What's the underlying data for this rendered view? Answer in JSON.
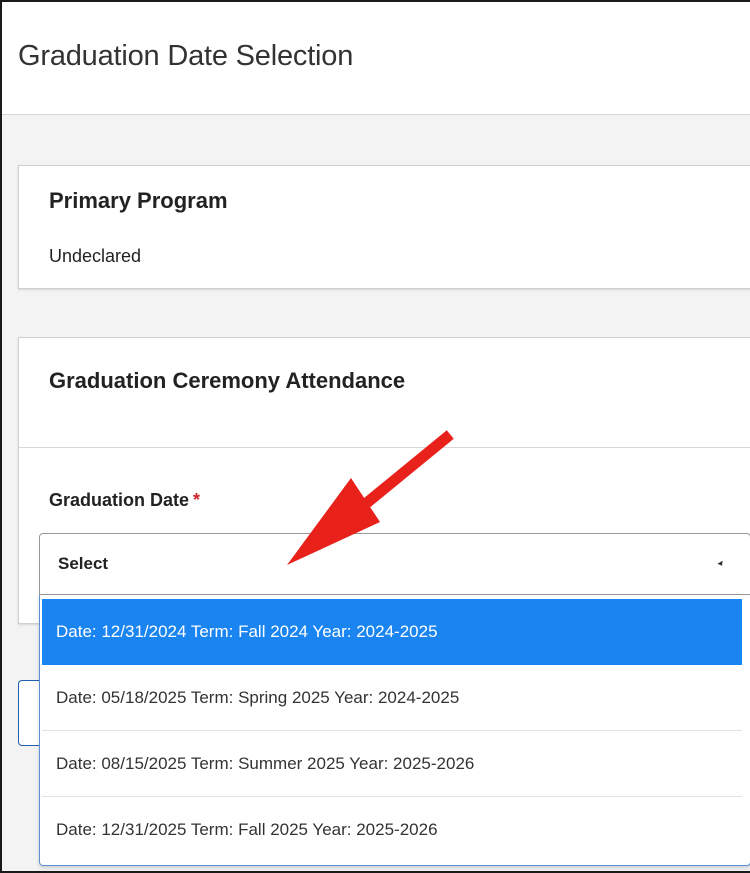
{
  "header": {
    "title": "Graduation Date Selection"
  },
  "primary_program": {
    "heading": "Primary Program",
    "value": "Undeclared"
  },
  "ceremony": {
    "heading": "Graduation Ceremony Attendance",
    "field_label": "Graduation Date",
    "required_marker": "*",
    "select_value": "Select",
    "options": [
      {
        "label": "Date: 12/31/2024 Term: Fall 2024 Year: 2024-2025",
        "highlighted": true
      },
      {
        "label": "Date: 05/18/2025 Term: Spring 2025 Year: 2024-2025",
        "highlighted": false
      },
      {
        "label": "Date: 08/15/2025 Term: Summer 2025 Year: 2025-2026",
        "highlighted": false
      },
      {
        "label": "Date: 12/31/2025 Term: Fall 2025 Year: 2025-2026",
        "highlighted": false
      }
    ]
  },
  "colors": {
    "highlight": "#1a84f0",
    "required": "#d0212b",
    "annotation_arrow": "#e8221b"
  },
  "icons": {
    "select_caret": "caret-down-icon",
    "annotation": "red-arrow-icon"
  }
}
